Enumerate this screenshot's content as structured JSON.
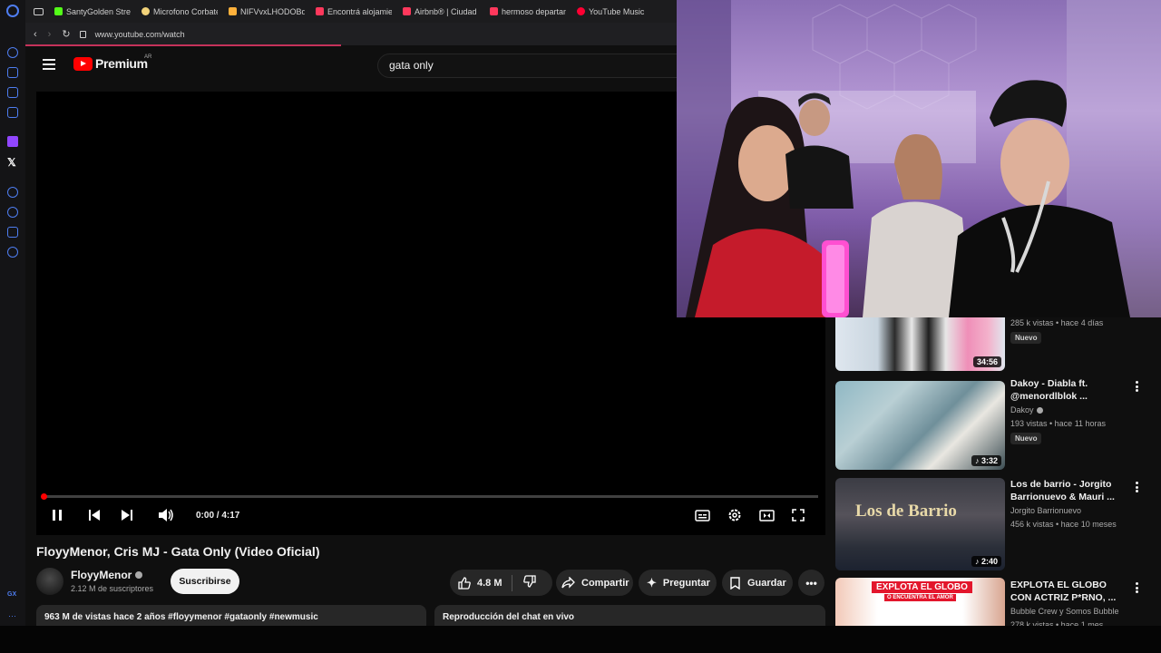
{
  "bookmarks": [
    {
      "label": "SantyGolden Strea",
      "color": "#53fc18"
    },
    {
      "label": "Microfono Corbate",
      "color": "#f2d37a"
    },
    {
      "label": "NIFVvxLHODOBdS",
      "color": "#ffb13b"
    },
    {
      "label": "Encontrá alojamie",
      "color": "#ff385c"
    },
    {
      "label": "Airbnb® | Ciudad d",
      "color": "#ff385c"
    },
    {
      "label": "hermoso departam",
      "color": "#ff385c"
    },
    {
      "label": "YouTube Music",
      "color": "#ff0033"
    }
  ],
  "address": {
    "url": "www.youtube.com/watch"
  },
  "youtube": {
    "logo_text": "Premium",
    "country": "AR",
    "search_value": "gata only"
  },
  "player": {
    "time": "0:00 / 4:17",
    "progress": 0.004
  },
  "video": {
    "title": "FloyyMenor, Cris MJ - Gata Only (Video Oficial)",
    "channel": "FloyyMenor",
    "subscribers": "2.12 M de suscriptores",
    "subscribe_label": "Suscribirse",
    "likes": "4.8 M",
    "share_label": "Compartir",
    "ask_label": "Preguntar",
    "save_label": "Guardar",
    "description": "963 M de vistas  hace 2 años  #floyymenor #gataonly #newmusic",
    "chat_label": "Reproducción del chat en vivo"
  },
  "recommendations": [
    {
      "title": "",
      "channel": "",
      "meta": "285 k vistas • hace 4 días",
      "badge": "Nuevo",
      "duration": "34:56"
    },
    {
      "title": "Dakoy - Diabla ft. @menordlblok ...",
      "channel": "Dakoy",
      "meta": "193 vistas • hace 11 horas",
      "badge": "Nuevo",
      "duration": "3:32"
    },
    {
      "title": "Los de barrio - Jorgito Barrionuevo & Mauri ...",
      "channel": "Jorgito Barrionuevo",
      "meta": "456 k vistas • hace 10 meses",
      "badge": "",
      "duration": "2:40",
      "thumb_text": "Los de Barrio"
    },
    {
      "title": "EXPLOTA EL GLOBO CON ACTRIZ P*RNO, ...",
      "channel": "Bubble Crew y Somos Bubble",
      "meta": "278 k vistas • hace 1 mes",
      "badge": "",
      "duration": "",
      "thumb_text": "EXPLOTA EL GLOBO",
      "thumb_sub": "O ENCUENTRA EL AMOR"
    }
  ],
  "colors": {
    "accent": "#ff0000",
    "bg": "#0f0f0f",
    "surface": "#272727"
  }
}
